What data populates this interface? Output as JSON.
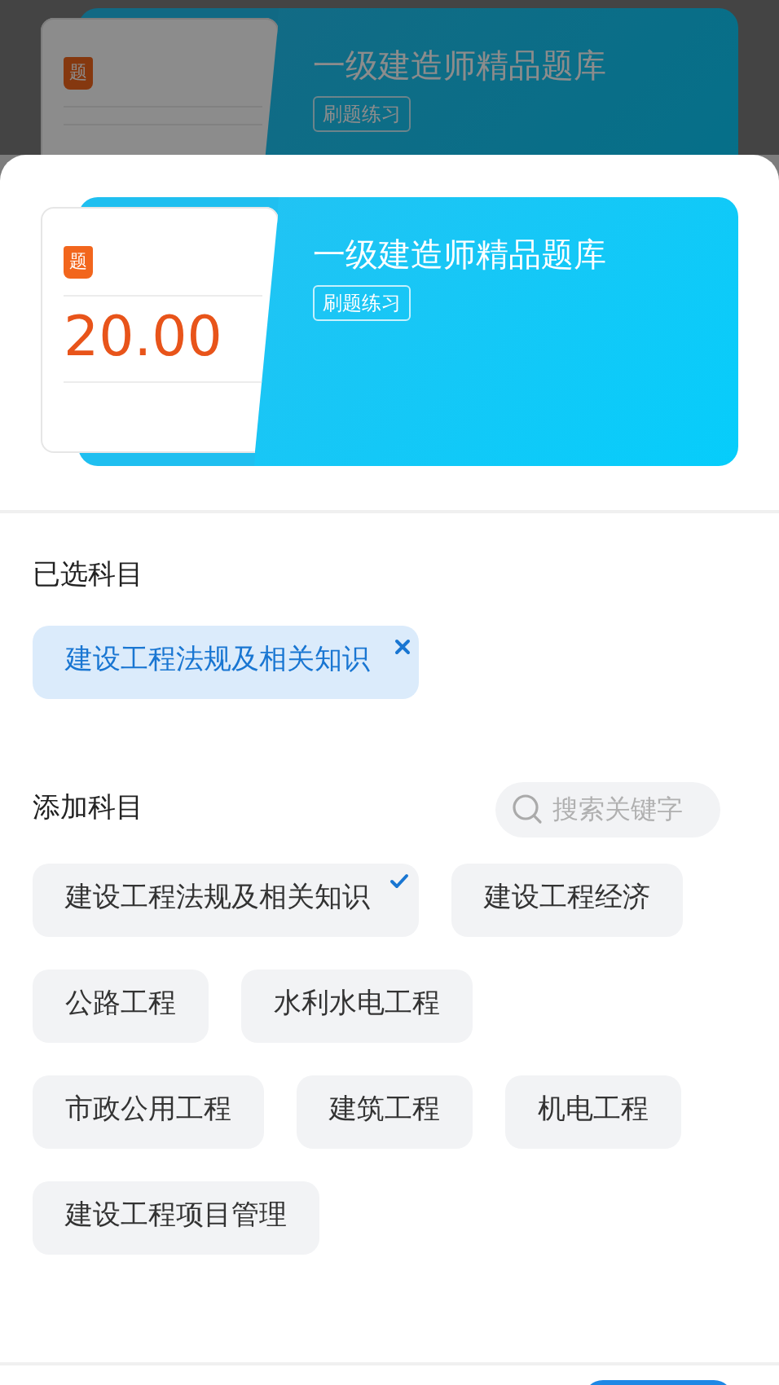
{
  "background_card": {
    "badge": "题",
    "title": "一级建造师精品题库",
    "tag": "刷题练习"
  },
  "card": {
    "badge": "题",
    "price": "20.00",
    "title": "一级建造师精品题库",
    "tag": "刷题练习"
  },
  "selected_section": {
    "title": "已选科目",
    "chips": [
      {
        "label": "建设工程法规及相关知识"
      }
    ]
  },
  "add_section": {
    "title": "添加科目",
    "search": {
      "placeholder": "搜索关键字"
    },
    "subjects": [
      {
        "label": "建设工程法规及相关知识",
        "selected": true
      },
      {
        "label": "建设工程经济",
        "selected": false
      },
      {
        "label": "公路工程",
        "selected": false
      },
      {
        "label": "水利水电工程",
        "selected": false
      },
      {
        "label": "市政公用工程",
        "selected": false
      },
      {
        "label": "建筑工程",
        "selected": false
      },
      {
        "label": "机电工程",
        "selected": false
      },
      {
        "label": "建设工程项目管理",
        "selected": false
      }
    ]
  }
}
